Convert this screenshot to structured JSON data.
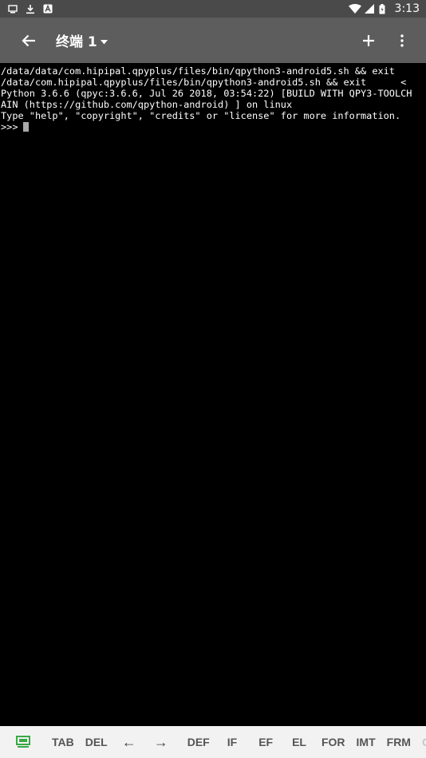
{
  "status_bar": {
    "time": "3:13",
    "left_icons": [
      "screen-icon",
      "download-icon",
      "notification-a-icon"
    ],
    "right_icons": [
      "wifi-icon",
      "signal-icon",
      "battery-icon"
    ]
  },
  "app_bar": {
    "title": "终端 1",
    "background": "#5d5d5d"
  },
  "terminal": {
    "lines": [
      "/data/data/com.hipipal.qpyplus/files/bin/qpython3-android5.sh && exit",
      "/data/com.hipipal.qpyplus/files/bin/qpython3-android5.sh && exit      <",
      "Python 3.6.6 (qpyc:3.6.6, Jul 26 2018, 03:54:22) [BUILD WITH QPY3-TOOLCH",
      "AIN (https://github.com/qpython-android) ] on linux",
      "Type \"help\", \"copyright\", \"credits\" or \"license\" for more information."
    ],
    "prompt": ">>>"
  },
  "keys_bar": {
    "keyboard_icon_color": "#3aa845",
    "keys": [
      "TAB",
      "DEL",
      "←",
      "→",
      "DEF",
      "IF",
      "EF",
      "EL",
      "FOR",
      "IMT",
      "FRM",
      "C"
    ]
  }
}
